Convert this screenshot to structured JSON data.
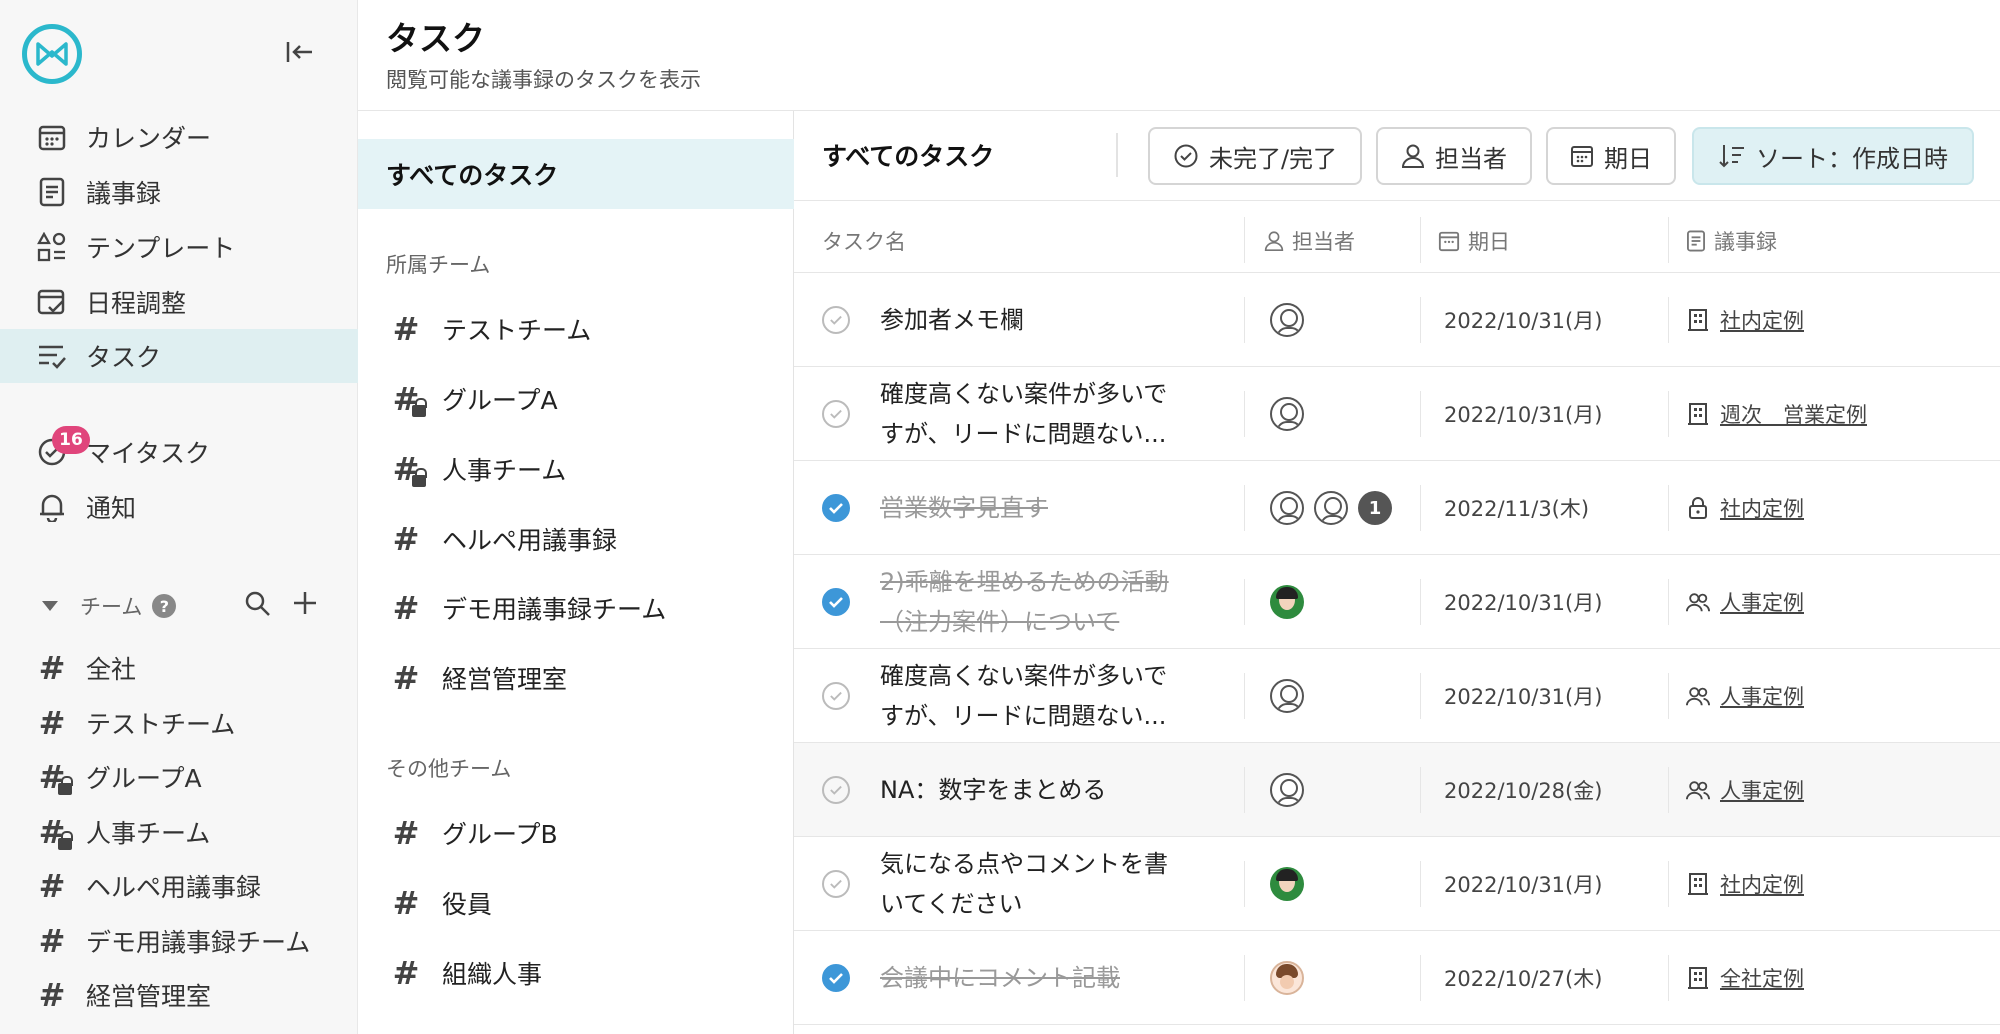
{
  "header": {
    "title": "タスク",
    "subtitle": "閲覧可能な議事録のタスクを表示"
  },
  "sidebar": {
    "nav": [
      {
        "label": "カレンダー",
        "icon": "calendar-icon"
      },
      {
        "label": "議事録",
        "icon": "document-icon"
      },
      {
        "label": "テンプレート",
        "icon": "template-icon"
      },
      {
        "label": "日程調整",
        "icon": "schedule-icon"
      },
      {
        "label": "タスク",
        "icon": "task-list-icon",
        "active": true
      }
    ],
    "my_tasks": {
      "label": "マイタスク",
      "badge": "16"
    },
    "notifications": {
      "label": "通知"
    },
    "team_section": {
      "label": "チーム",
      "help": "?"
    },
    "teams": [
      {
        "label": "全社",
        "private": false
      },
      {
        "label": "テストチーム",
        "private": false
      },
      {
        "label": "グループA",
        "private": true
      },
      {
        "label": "人事チーム",
        "private": true
      },
      {
        "label": "ヘルペ用議事録",
        "private": false
      },
      {
        "label": "デモ用議事録チーム",
        "private": false
      },
      {
        "label": "経営管理室",
        "private": false
      }
    ]
  },
  "filter_panel": {
    "all_tasks": "すべてのタスク",
    "own_teams_label": "所属チーム",
    "own_teams": [
      {
        "label": "テストチーム",
        "private": false
      },
      {
        "label": "グループA",
        "private": true
      },
      {
        "label": "人事チーム",
        "private": true
      },
      {
        "label": "ヘルペ用議事録",
        "private": false
      },
      {
        "label": "デモ用議事録チーム",
        "private": false
      },
      {
        "label": "経営管理室",
        "private": false
      }
    ],
    "other_teams_label": "その他チーム",
    "other_teams": [
      {
        "label": "グループB",
        "private": false
      },
      {
        "label": "役員",
        "private": false
      },
      {
        "label": "組織人事",
        "private": false
      }
    ]
  },
  "toolbar": {
    "title": "すべてのタスク",
    "status_filter": "未完了/完了",
    "assignee_filter": "担当者",
    "due_filter": "期日",
    "sort": "ソート：作成日時"
  },
  "table": {
    "columns": {
      "name": "タスク名",
      "assignee": "担当者",
      "due": "期日",
      "minutes": "議事録"
    },
    "rows": [
      {
        "name_lines": [
          "参加者メモ欄"
        ],
        "done": false,
        "assignees": [
          "line"
        ],
        "extra": "",
        "due": "2022/10/31(月)",
        "minutes": "社内定例",
        "minutes_icon": "building-icon"
      },
      {
        "name_lines": [
          "確度高くない案件が多いで",
          "すが、リードに問題ない..."
        ],
        "done": false,
        "assignees": [
          "line"
        ],
        "extra": "",
        "due": "2022/10/31(月)",
        "minutes": "週次　営業定例",
        "minutes_icon": "building-icon"
      },
      {
        "name_lines": [
          "営業数字見直す"
        ],
        "done": true,
        "assignees": [
          "line",
          "line"
        ],
        "extra": "1",
        "due": "2022/11/3(木)",
        "minutes": "社内定例",
        "minutes_icon": "lock-icon"
      },
      {
        "name_lines": [
          "2)乖離を埋めるための活動",
          "（注力案件）について"
        ],
        "done": true,
        "assignees": [
          "green"
        ],
        "extra": "",
        "due": "2022/10/31(月)",
        "minutes": "人事定例",
        "minutes_icon": "people-icon"
      },
      {
        "name_lines": [
          "確度高くない案件が多いで",
          "すが、リードに問題ない..."
        ],
        "done": false,
        "assignees": [
          "line"
        ],
        "extra": "",
        "due": "2022/10/31(月)",
        "minutes": "人事定例",
        "minutes_icon": "people-icon"
      },
      {
        "name_lines": [
          "NA：数字をまとめる"
        ],
        "done": false,
        "assignees": [
          "line"
        ],
        "extra": "",
        "due": "2022/10/28(金)",
        "minutes": "人事定例",
        "minutes_icon": "people-icon",
        "hover": true
      },
      {
        "name_lines": [
          "気になる点やコメントを書",
          "いてください"
        ],
        "done": false,
        "assignees": [
          "green"
        ],
        "extra": "",
        "due": "2022/10/31(月)",
        "minutes": "社内定例",
        "minutes_icon": "building-icon"
      },
      {
        "name_lines": [
          "会議中にコメント記載"
        ],
        "done": true,
        "assignees": [
          "warm"
        ],
        "extra": "",
        "due": "2022/10/27(木)",
        "minutes": "全社定例",
        "minutes_icon": "building-icon"
      }
    ]
  },
  "colors": {
    "brand": "#2bb8cc",
    "active_bg": "#dfeff1",
    "done_check": "#3d97d8",
    "badge": "#e0457b"
  }
}
